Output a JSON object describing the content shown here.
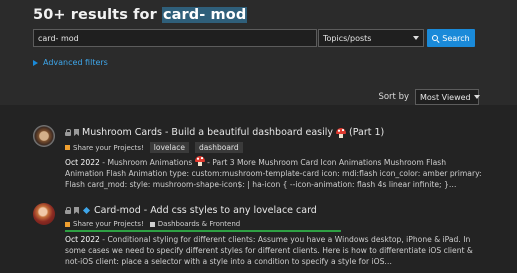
{
  "search": {
    "title_prefix": "50+ results for ",
    "title_query": "card- mod",
    "input_value": "card- mod",
    "scope_select": "Topics/posts",
    "button_label": "Search",
    "advanced_filters_label": "Advanced filters"
  },
  "sort": {
    "label": "Sort by",
    "selected": "Most Viewed"
  },
  "results": [
    {
      "title": "Mushroom Cards - Build a beautiful dashboard easily",
      "title_suffix": "(Part 1)",
      "category": "Share your Projects!",
      "category_color": "#f0a030",
      "tags": [
        "lovelace",
        "dashboard"
      ],
      "date": "Oct 2022",
      "blurb_lead": " - Mushroom Animations ",
      "blurb_rest": " - Part 3 More Mushroom Card Icon Animations Mushroom Flash Animation Flash Animation type: custom:mushroom-template-card icon: mdi:flash icon_color: amber primary: Flash card_mod: style: mushroom-shape-icon$: | ha-icon { --icon-animation: flash 4s linear infinite; }…"
    },
    {
      "title": "Card-mod - Add css styles to any lovelace card",
      "category": "Share your Projects!",
      "category_color": "#f0a030",
      "subcategory": "Dashboards & Frontend",
      "subcategory_color": "#d0d0d0",
      "date": "Oct 2022",
      "blurb_rest": " - Conditional styling for different clients: Assume you have a Windows desktop, iPhone & iPad. In some cases we need to specify different styles for different clients. Here is how to differentiate iOS client & not-iOS client: place a selector with a style into a condition to specify a style for iOS…"
    }
  ]
}
